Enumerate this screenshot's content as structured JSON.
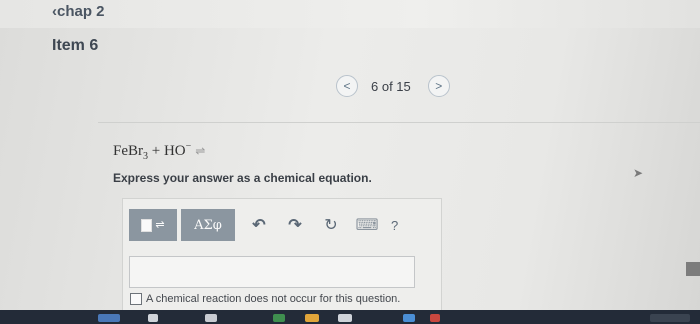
{
  "nav": {
    "back_label": "‹chap 2",
    "item_title": "Item 6"
  },
  "pager": {
    "count": "6 of 15",
    "prev_symbol": "<",
    "next_symbol": ">"
  },
  "question": {
    "reactant1": "FeBr",
    "reactant1_sub": "3",
    "plus": " + ",
    "reactant2": "HO",
    "reactant2_sup": "−",
    "arrow": "⇌",
    "instruction": "Express your answer as a chemical equation."
  },
  "toolbar": {
    "greek_label": "ΑΣφ",
    "undo_symbol": "↶",
    "redo_symbol": "↷",
    "reset_symbol": "↻",
    "keyboard_symbol": "⌨",
    "help_label": "?"
  },
  "answer": {
    "value": ""
  },
  "no_reaction": {
    "label": "A chemical reaction does not occur for this question."
  }
}
